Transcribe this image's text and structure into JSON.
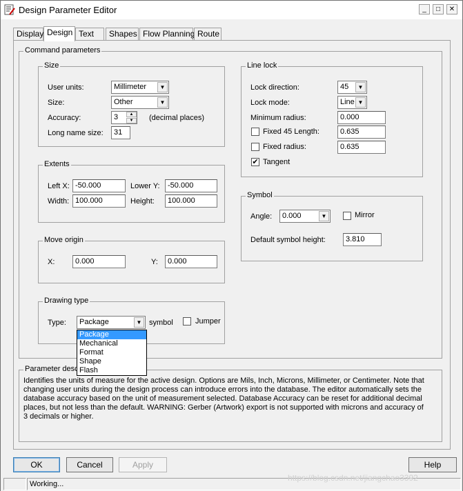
{
  "window": {
    "title": "Design Parameter Editor"
  },
  "tabs": [
    {
      "label": "Display"
    },
    {
      "label": "Design"
    },
    {
      "label": "Text"
    },
    {
      "label": "Shapes"
    },
    {
      "label": "Flow Planning"
    },
    {
      "label": "Route"
    }
  ],
  "command_parameters": {
    "label": "Command parameters"
  },
  "size": {
    "label": "Size",
    "user_units_label": "User units:",
    "user_units_value": "Millimeter",
    "size_label": "Size:",
    "size_value": "Other",
    "accuracy_label": "Accuracy:",
    "accuracy_value": "3",
    "accuracy_suffix": "(decimal places)",
    "long_name_label": "Long name size:",
    "long_name_value": "31"
  },
  "extents": {
    "label": "Extents",
    "left_x_label": "Left X:",
    "left_x_value": "-50.000",
    "lower_y_label": "Lower Y:",
    "lower_y_value": "-50.000",
    "width_label": "Width:",
    "width_value": "100.000",
    "height_label": "Height:",
    "height_value": "100.000"
  },
  "move_origin": {
    "label": "Move origin",
    "x_label": "X:",
    "x_value": "0.000",
    "y_label": "Y:",
    "y_value": "0.000"
  },
  "drawing_type": {
    "label": "Drawing type",
    "type_label": "Type:",
    "type_value": "Package",
    "symbol_label": "symbol",
    "jumper_label": "Jumper",
    "options": [
      "Package",
      "Mechanical",
      "Format",
      "Shape",
      "Flash"
    ]
  },
  "line_lock": {
    "label": "Line lock",
    "lock_direction_label": "Lock direction:",
    "lock_direction_value": "45",
    "lock_mode_label": "Lock mode:",
    "lock_mode_value": "Line",
    "min_radius_label": "Minimum radius:",
    "min_radius_value": "0.000",
    "fixed45_label": "Fixed 45 Length:",
    "fixed45_value": "0.635",
    "fixed_radius_label": "Fixed radius:",
    "fixed_radius_value": "0.635",
    "tangent_label": "Tangent"
  },
  "symbol": {
    "label": "Symbol",
    "angle_label": "Angle:",
    "angle_value": "0.000",
    "mirror_label": "Mirror",
    "default_height_label": "Default symbol height:",
    "default_height_value": "3.810"
  },
  "parameter_description": {
    "label": "Parameter desc",
    "text": "Identifies the units of measure for the active design. Options are Mils, Inch, Microns, Millimeter, or Centimeter. Note that changing user units during the design process can introduce errors into the database.  The editor automatically sets the database accuracy based on the unit of measurement selected. Database Accuracy can be reset for additional decimal places, but not less than the default. WARNING: Gerber (Artwork) export is not supported with microns and accuracy of 3 decimals or higher."
  },
  "buttons": {
    "ok": "OK",
    "cancel": "Cancel",
    "apply": "Apply",
    "help": "Help"
  },
  "status": {
    "text": "Working..."
  },
  "watermark": "https://blog.csdn.net/jiangchao3392"
}
